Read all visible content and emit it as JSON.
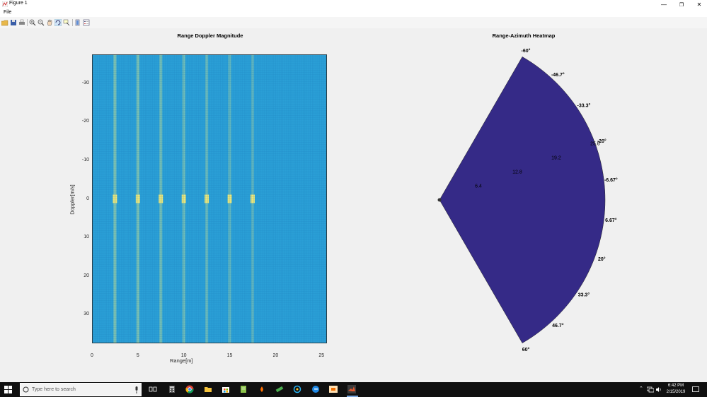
{
  "window": {
    "title": "Figure 1"
  },
  "menu": {
    "file": "File"
  },
  "plot1": {
    "title": "Range Doppler Magnitude",
    "xlabel": "Range[m]",
    "ylabel": "Doppler[m/s]"
  },
  "plot2": {
    "title": "Range-Azimuth Heatmap",
    "angle_labels": [
      "-60°",
      "-46.7°",
      "-33.3°",
      "-20°",
      "-6.67°",
      "6.67°",
      "20°",
      "33.3°",
      "46.7°",
      "60°"
    ],
    "range_labels": [
      "6.4",
      "12.8",
      "19.2",
      "25.6"
    ]
  },
  "chart_data": [
    {
      "type": "heatmap",
      "title": "Range Doppler Magnitude",
      "xlabel": "Range[m]",
      "ylabel": "Doppler[m/s]",
      "xlim": [
        0,
        25.6
      ],
      "ylim": [
        -37.5,
        37.5
      ],
      "y_reversed": true,
      "xticks": [
        0,
        5,
        10,
        15,
        20,
        25
      ],
      "yticks": [
        -30,
        -20,
        -10,
        0,
        10,
        20,
        30
      ],
      "xtick_labels": [
        "0",
        "5",
        "10",
        "15",
        "20",
        "25"
      ],
      "ytick_labels": [
        "-30",
        "-20",
        "-10",
        "0",
        "10",
        "20",
        "30"
      ],
      "bright_range_columns": [
        2.5,
        5,
        7.5,
        10,
        12.5,
        15,
        17.5
      ],
      "colors": {
        "low": "#2a9fd6",
        "mid": "#6fd1b9",
        "high": "#f0e978"
      }
    },
    {
      "type": "heatmap",
      "title": "Range-Azimuth Heatmap",
      "projection": "polar-sector",
      "azimuth_range": [
        -60,
        60
      ],
      "range_max": 25.6,
      "azimuth_ticks": [
        -60,
        -46.7,
        -33.3,
        -20,
        -6.67,
        6.67,
        20,
        33.3,
        46.7,
        60
      ],
      "range_ticks": [
        6.4,
        12.8,
        19.2,
        25.6
      ],
      "fill_color": "#352a87"
    }
  ],
  "taskbar": {
    "search_placeholder": "Type here to search",
    "time": "6:42 PM",
    "date": "2/15/2019"
  }
}
